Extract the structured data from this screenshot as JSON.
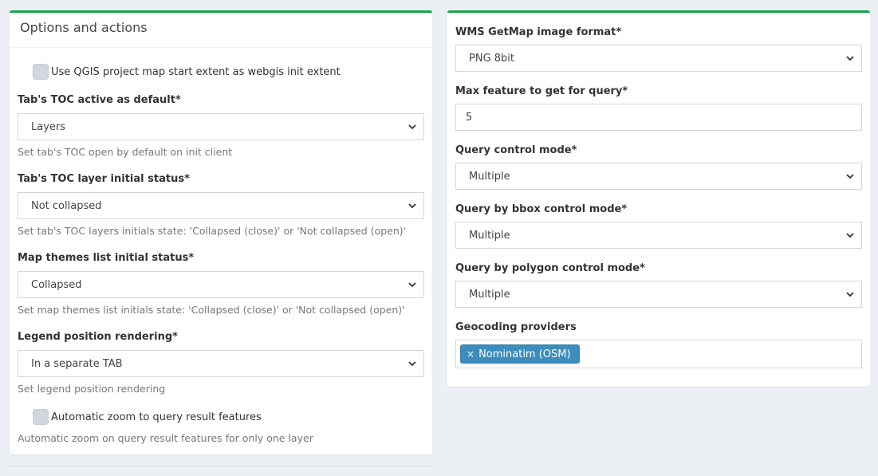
{
  "left_panel": {
    "title": "Options and actions",
    "start_extent_checkbox": "Use QGIS project map start extent as webgis init extent",
    "toc_default": {
      "label": "Tab's TOC active as default*",
      "value": "Layers",
      "help": "Set tab's TOC open by default on init client"
    },
    "toc_layer_status": {
      "label": "Tab's TOC layer initial status*",
      "value": "Not collapsed",
      "help": "Set tab's TOC layers initials state: 'Collapsed (close)' or 'Not collapsed (open)'"
    },
    "map_themes_status": {
      "label": "Map themes list initial status*",
      "value": "Collapsed",
      "help": "Set map themes list initials state: 'Collapsed (close)' or 'Not collapsed (open)'"
    },
    "legend_position": {
      "label": "Legend position rendering*",
      "value": "In a separate TAB",
      "help": "Set legend position rendering"
    },
    "auto_zoom_checkbox": "Automatic zoom to query result features",
    "auto_zoom_help": "Automatic zoom on query result features for only one layer"
  },
  "right_panel": {
    "wms_format": {
      "label": "WMS GetMap image format*",
      "value": "PNG 8bit"
    },
    "max_feature": {
      "label": "Max feature to get for query*",
      "value": "5"
    },
    "query_control": {
      "label": "Query control mode*",
      "value": "Multiple"
    },
    "query_bbox": {
      "label": "Query by bbox control mode*",
      "value": "Multiple"
    },
    "query_polygon": {
      "label": "Query by polygon control mode*",
      "value": "Multiple"
    },
    "geocoding": {
      "label": "Geocoding providers",
      "tags": [
        "Nominatim (OSM)"
      ],
      "remove_glyph": "×"
    }
  },
  "colors": {
    "panel_border": "#16a34a",
    "tag_bg": "#3c8dbc",
    "page_bg": "#ecf0f5"
  },
  "icons": {
    "select_arrow": "chevron-down-icon",
    "tag_remove": "close-icon"
  }
}
